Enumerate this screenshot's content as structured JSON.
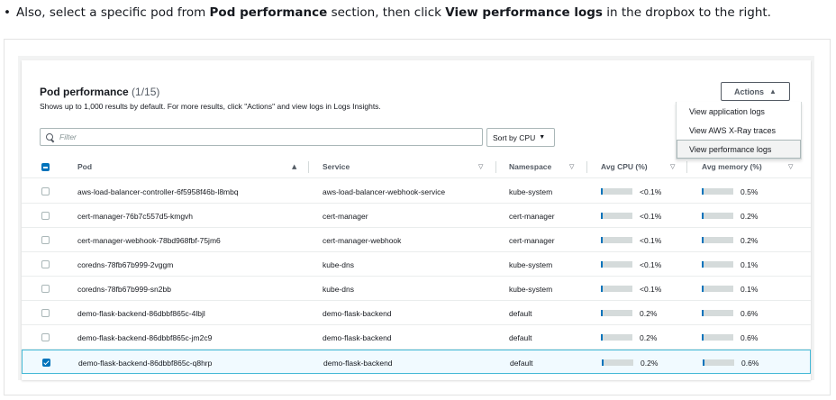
{
  "instruction": {
    "prefix": "Also, select a specific pod from",
    "bold1": "Pod performance",
    "middle": "section, then click",
    "bold2": "View performance logs",
    "suffix": "in the dropbox to the right."
  },
  "card": {
    "title": "Pod performance",
    "count": "(1/15)",
    "description": "Shows up to 1,000 results by default. For more results, click \"Actions\" and view logs in Logs Insights."
  },
  "actions": {
    "label": "Actions",
    "items": [
      "View application logs",
      "View AWS X-Ray traces",
      "View performance logs"
    ],
    "highlighted_index": 2
  },
  "filter": {
    "placeholder": "Filter"
  },
  "sort": {
    "label": "Sort by CPU"
  },
  "columns": [
    "Pod",
    "Service",
    "Namespace",
    "Avg CPU (%)",
    "Avg memory (%)"
  ],
  "rows": [
    {
      "pod": "aws-load-balancer-controller-6f5958f46b-l8mbq",
      "service": "aws-load-balancer-webhook-service",
      "namespace": "kube-system",
      "cpu": "<0.1%",
      "cpu_fraction": 0.05,
      "memory": "0.5%",
      "memory_fraction": 0.05,
      "selected": false
    },
    {
      "pod": "cert-manager-76b7c557d5-kmgvh",
      "service": "cert-manager",
      "namespace": "cert-manager",
      "cpu": "<0.1%",
      "cpu_fraction": 0.05,
      "memory": "0.2%",
      "memory_fraction": 0.05,
      "selected": false
    },
    {
      "pod": "cert-manager-webhook-78bd968fbf-75jm6",
      "service": "cert-manager-webhook",
      "namespace": "cert-manager",
      "cpu": "<0.1%",
      "cpu_fraction": 0.05,
      "memory": "0.2%",
      "memory_fraction": 0.05,
      "selected": false
    },
    {
      "pod": "coredns-78fb67b999-2vggm",
      "service": "kube-dns",
      "namespace": "kube-system",
      "cpu": "<0.1%",
      "cpu_fraction": 0.05,
      "memory": "0.1%",
      "memory_fraction": 0.05,
      "selected": false
    },
    {
      "pod": "coredns-78fb67b999-sn2bb",
      "service": "kube-dns",
      "namespace": "kube-system",
      "cpu": "<0.1%",
      "cpu_fraction": 0.05,
      "memory": "0.1%",
      "memory_fraction": 0.05,
      "selected": false
    },
    {
      "pod": "demo-flask-backend-86dbbf865c-4lbjl",
      "service": "demo-flask-backend",
      "namespace": "default",
      "cpu": "0.2%",
      "cpu_fraction": 0.05,
      "memory": "0.6%",
      "memory_fraction": 0.05,
      "selected": false
    },
    {
      "pod": "demo-flask-backend-86dbbf865c-jm2c9",
      "service": "demo-flask-backend",
      "namespace": "default",
      "cpu": "0.2%",
      "cpu_fraction": 0.05,
      "memory": "0.6%",
      "memory_fraction": 0.05,
      "selected": false
    },
    {
      "pod": "demo-flask-backend-86dbbf865c-q8hrp",
      "service": "demo-flask-backend",
      "namespace": "default",
      "cpu": "0.2%",
      "cpu_fraction": 0.05,
      "memory": "0.6%",
      "memory_fraction": 0.05,
      "selected": true
    }
  ],
  "colors": {
    "accent": "#0073bb",
    "selected_border": "#44b9d6",
    "selected_bg": "#f1faff"
  },
  "icons": {
    "filter": "search-icon",
    "sort": "caret-down-icon",
    "actions": "caret-up-icon"
  }
}
